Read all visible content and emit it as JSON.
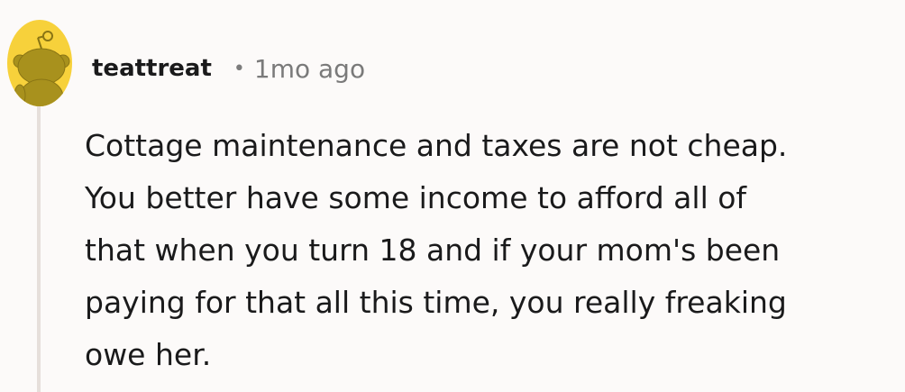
{
  "comment": {
    "author": "teattreat",
    "separator": "•",
    "timestamp": "1mo ago",
    "body": "Cottage maintenance and taxes are not cheap.\nYou better have some income to afford all of\nthat when you turn 18 and if your mom's been\npaying for that all this time, you really freaking\nowe her.",
    "avatar_icon": "snoo-avatar-icon",
    "colors": {
      "avatar_bg": "#f7d13b",
      "snoo": "#a8911d",
      "thread_line": "#e6dfdb"
    }
  }
}
